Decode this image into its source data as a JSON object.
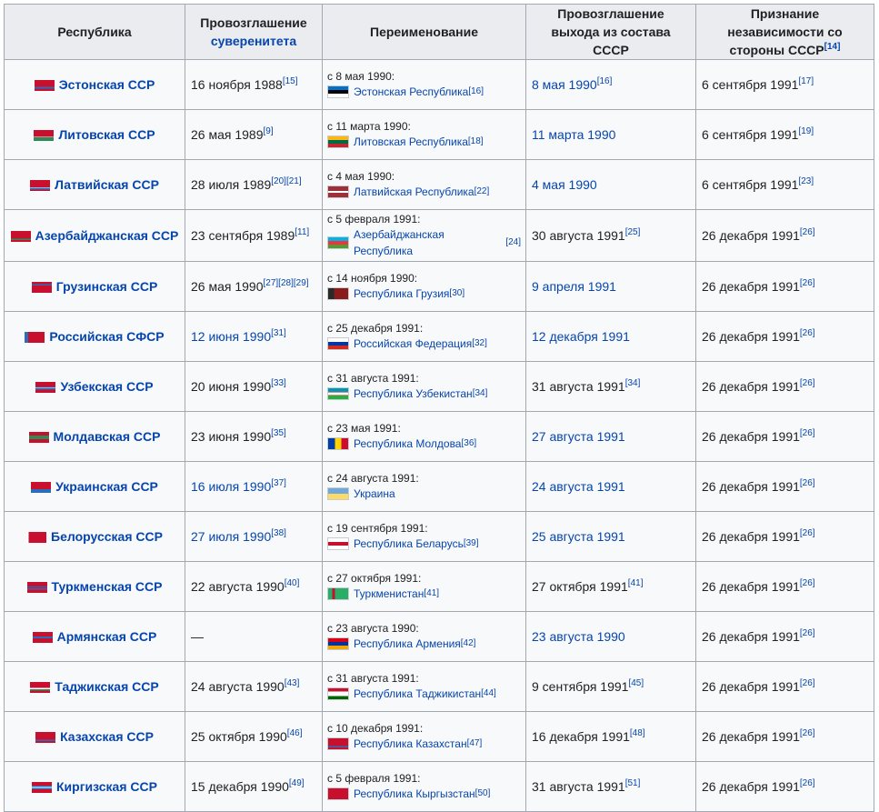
{
  "headers": {
    "republic": "Республика",
    "sovereignty_line1": "Провозглашение",
    "sovereignty_line2": "суверенитета",
    "rename": "Переименование",
    "exit": "Провозглашение выхода из состава СССР",
    "recognition": "Признание независимости со стороны СССР",
    "recognition_ref": "[14]"
  },
  "rows": [
    {
      "republic": "Эстонская ССР",
      "sov": "16 ноября 1988",
      "sov_link": false,
      "sov_ref": "[15]",
      "rename_date": "с 8 мая 1990:",
      "rename_name": "Эстонская Республика",
      "rename_ref": "[16]",
      "exit": "8 мая 1990",
      "exit_link": true,
      "exit_ref": "[16]",
      "recog": "6 сентября 1991",
      "recog_ref": "[17]",
      "sflag": "linear-gradient(#c8102e 0 62%, #2a6ebb 62% 80%, #c8102e 80%)",
      "flag": "linear-gradient(#0072ce 0 33%, #000 33% 66%, #fff 66%)"
    },
    {
      "republic": "Литовская ССР",
      "sov": "26 мая 1989",
      "sov_link": false,
      "sov_ref": "[9]",
      "rename_date": "с 11 марта 1990:",
      "rename_name": "Литовская Республика",
      "rename_ref": "[18]",
      "exit": "11 марта 1990",
      "exit_link": true,
      "exit_ref": "",
      "recog": "6 сентября 1991",
      "recog_ref": "[19]",
      "sflag": "linear-gradient(#c8102e 0 62%, #fff 62% 68%, #2e8b57 68%)",
      "flag": "linear-gradient(#fdb913 0 33%, #006a44 33% 66%, #c1272d 66%)"
    },
    {
      "republic": "Латвийская ССР",
      "sov": "28 июля 1989",
      "sov_link": false,
      "sov_ref": "[20][21]",
      "rename_date": "с 4 мая 1990:",
      "rename_name": "Латвийская Республика",
      "rename_ref": "[22]",
      "exit": "4 мая 1990",
      "exit_link": true,
      "exit_ref": "",
      "recog": "6 сентября 1991",
      "recog_ref": "[23]",
      "sflag": "linear-gradient(#c8102e 0 66%, #fff 66% 72%, #2a6ebb 72% 86%, #c8102e 86%)",
      "flag": "linear-gradient(#9e3039 0 40%, #fff 40% 60%, #9e3039 60%)"
    },
    {
      "republic": "Азербайджанская ССР",
      "sov": "23 сентября 1989",
      "sov_link": false,
      "sov_ref": "[11]",
      "rename_date": "с 5 февраля 1991:",
      "rename_name": "Азербайджанская Республика",
      "rename_ref": "[24]",
      "exit": "30 августа 1991",
      "exit_link": false,
      "exit_ref": "[25]",
      "recog": "26 декабря 1991",
      "recog_ref": "[26]",
      "sflag": "linear-gradient(#c8102e 0 70%, #2e8b57 70% 85%, #c8102e 85%)",
      "flag": "linear-gradient(#00b5e2 0 33%, #ef3340 33% 66%, #509e2f 66%)"
    },
    {
      "republic": "Грузинская ССР",
      "sov": "26 мая 1990",
      "sov_link": false,
      "sov_ref": "[27][28][29]",
      "rename_date": "с 14 ноября 1990:",
      "rename_name": "Республика Грузия",
      "rename_ref": "[30]",
      "exit": "9 апреля 1991",
      "exit_link": true,
      "exit_ref": "",
      "recog": "26 декабря 1991",
      "recog_ref": "[26]",
      "sflag": "linear-gradient(#c8102e 0 20%, #2a6ebb 20% 35%, #c8102e 35%)",
      "flag": "linear-gradient(90deg, #2a2a2a 0 30%, #8b1a1a 30%)"
    },
    {
      "republic": "Российская СФСР",
      "sov": "12 июня 1990",
      "sov_link": true,
      "sov_ref": "[31]",
      "rename_date": "с 25 декабря 1991:",
      "rename_name": "Российская Федерация",
      "rename_ref": "[32]",
      "exit": "12 декабря 1991",
      "exit_link": true,
      "exit_ref": "",
      "recog": "26 декабря 1991",
      "recog_ref": "[26]",
      "sflag": "linear-gradient(90deg, #2a6ebb 0 18%, #c8102e 18%)",
      "flag": "linear-gradient(#fff 0 33%, #0039a6 33% 66%, #d52b1e 66%)"
    },
    {
      "republic": "Узбекская ССР",
      "sov": "20 июня 1990",
      "sov_link": false,
      "sov_ref": "[33]",
      "rename_date": "с 31 августа 1991:",
      "rename_name": "Республика Узбекистан",
      "rename_ref": "[34]",
      "exit": "31 августа 1991",
      "exit_link": false,
      "exit_ref": "[34]",
      "recog": "26 декабря 1991",
      "recog_ref": "[26]",
      "sflag": "linear-gradient(#c8102e 0 45%, #2a6ebb 45% 55%, #fff 55% 60%, #2a6ebb 60% 70%, #c8102e 70%)",
      "flag": "linear-gradient(#0099b5 0 32%, #ce1126 32% 36%, #fff 36% 64%, #ce1126 64% 68%, #1eb53a 68%)"
    },
    {
      "republic": "Молдавская ССР",
      "sov": "23 июня 1990",
      "sov_link": false,
      "sov_ref": "[35]",
      "rename_date": "с 23 мая 1991:",
      "rename_name": "Республика Молдова",
      "rename_ref": "[36]",
      "exit": "27 августа 1991",
      "exit_link": true,
      "exit_ref": "",
      "recog": "26 декабря 1991",
      "recog_ref": "[26]",
      "sflag": "linear-gradient(#c8102e 0 35%, #2e8b57 35% 65%, #c8102e 65%)",
      "flag": "linear-gradient(90deg, #003da5 0 33%, #ffd200 33% 66%, #cc092f 66%)"
    },
    {
      "republic": "Украинская ССР",
      "sov": "16 июля 1990",
      "sov_link": true,
      "sov_ref": "[37]",
      "rename_date": "с 24 августа 1991:",
      "rename_name": "Украина",
      "rename_ref": "",
      "exit": "24 августа 1991",
      "exit_link": true,
      "exit_ref": "",
      "recog": "26 декабря 1991",
      "recog_ref": "[26]",
      "sflag": "linear-gradient(#c8102e 0 66%, #2a6ebb 66%)",
      "flag": "linear-gradient(#6fa8dc 0 50%, #ffd966 50%)"
    },
    {
      "republic": "Белорусская ССР",
      "sov": "27 июля 1990",
      "sov_link": true,
      "sov_ref": "[38]",
      "rename_date": "с 19 сентября 1991:",
      "rename_name": "Республика Беларусь",
      "rename_ref": "[39]",
      "exit": "25 августа 1991",
      "exit_link": true,
      "exit_ref": "",
      "recog": "26 декабря 1991",
      "recog_ref": "[26]",
      "sflag": "linear-gradient(90deg, #fff 0 12%, #c8102e 12%)",
      "flag": "linear-gradient(#fff 0 33%, #c8102e 33% 66%, #fff 66%)"
    },
    {
      "republic": "Туркменская ССР",
      "sov": "22 августа 1990",
      "sov_link": false,
      "sov_ref": "[40]",
      "rename_date": "с 27 октября 1991:",
      "rename_name": "Туркменистан",
      "rename_ref": "[41]",
      "exit": "27 октября 1991",
      "exit_link": false,
      "exit_ref": "[41]",
      "recog": "26 декабря 1991",
      "recog_ref": "[26]",
      "sflag": "linear-gradient(#c8102e 0 40%, #2a6ebb 40% 50%, #c8102e 50% 60%, #2a6ebb 60% 70%, #c8102e 70%)",
      "flag": "linear-gradient(90deg, #28ae66 0 20%, #c8102e 20% 35%, #28ae66 35%)"
    },
    {
      "republic": "Армянская ССР",
      "sov": "—",
      "sov_link": false,
      "sov_ref": "",
      "rename_date": "с 23 августа 1990:",
      "rename_name": "Республика Армения",
      "rename_ref": "[42]",
      "exit": "23 августа 1990",
      "exit_link": true,
      "exit_ref": "",
      "recog": "26 декабря 1991",
      "recog_ref": "[26]",
      "sflag": "linear-gradient(#c8102e 0 40%, #2a6ebb 40% 60%, #c8102e 60%)",
      "flag": "linear-gradient(#d90012 0 33%, #0033a0 33% 66%, #f2a800 66%)"
    },
    {
      "republic": "Таджикская ССР",
      "sov": "24 августа 1990",
      "sov_link": false,
      "sov_ref": "[43]",
      "rename_date": "с 31 августа 1991:",
      "rename_name": "Республика Таджикистан",
      "rename_ref": "[44]",
      "exit": "9 сентября 1991",
      "exit_link": false,
      "exit_ref": "[45]",
      "recog": "26 декабря 1991",
      "recog_ref": "[26]",
      "sflag": "linear-gradient(#c8102e 0 55%, #fff 55% 65%, #2e8b57 65% 80%, #c8102e 80%)",
      "flag": "linear-gradient(#c8102e 0 30%, #fff 30% 70%, #006600 70%)"
    },
    {
      "republic": "Казахская ССР",
      "sov": "25 октября 1990",
      "sov_link": false,
      "sov_ref": "[46]",
      "rename_date": "с 10 декабря 1991:",
      "rename_name": "Республика Казахстан",
      "rename_ref": "[47]",
      "exit": "16 декабря 1991",
      "exit_link": false,
      "exit_ref": "[48]",
      "recog": "26 декабря 1991",
      "recog_ref": "[26]",
      "sflag": "linear-gradient(#c8102e 0 70%, #2a6ebb 70% 82%, #c8102e 82%)",
      "flag": "linear-gradient(#c8102e 0 70%, #2a6ebb 70% 82%, #c8102e 82%)"
    },
    {
      "republic": "Киргизская ССР",
      "sov": "15 декабря 1990",
      "sov_link": false,
      "sov_ref": "[49]",
      "rename_date": "с 5 февраля 1991:",
      "rename_name": "Республика Кыргызстан",
      "rename_ref": "[50]",
      "exit": "31 августа 1991",
      "exit_link": false,
      "exit_ref": "[51]",
      "recog": "26 декабря 1991",
      "recog_ref": "[26]",
      "sflag": "linear-gradient(#c8102e 0 35%, #2a6ebb 35% 45%, #fff 45% 55%, #2a6ebb 55% 65%, #c8102e 65%)",
      "flag": "linear-gradient(#c8102e 0 100%)"
    }
  ]
}
